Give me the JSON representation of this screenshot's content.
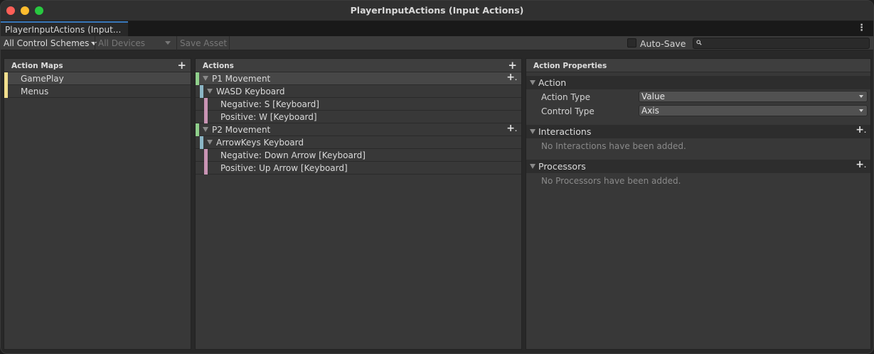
{
  "window": {
    "title": "PlayerInputActions (Input Actions)"
  },
  "tab": {
    "label": "PlayerInputActions (Input..."
  },
  "toolbar": {
    "control_schemes": "All Control Schemes",
    "devices": "All Devices",
    "save_asset": "Save Asset",
    "auto_save": "Auto-Save",
    "search_value": ""
  },
  "action_maps": {
    "header": "Action Maps",
    "items": [
      {
        "label": "GamePlay",
        "color": "#f2df8e"
      },
      {
        "label": "Menus",
        "color": "#f2df8e"
      }
    ]
  },
  "actions": {
    "header": "Actions",
    "rows": [
      {
        "label": "P1 Movement",
        "kind": "action",
        "color": "#8fcf8b"
      },
      {
        "label": "WASD Keyboard",
        "kind": "composite",
        "color": "#8bb6c6"
      },
      {
        "label": "Negative: S [Keyboard]",
        "kind": "binding",
        "color": "#c994b4"
      },
      {
        "label": "Positive: W [Keyboard]",
        "kind": "binding",
        "color": "#c994b4"
      },
      {
        "label": "P2 Movement",
        "kind": "action",
        "color": "#8fcf8b"
      },
      {
        "label": "ArrowKeys Keyboard",
        "kind": "composite",
        "color": "#8bb6c6"
      },
      {
        "label": "Negative: Down Arrow [Keyboard]",
        "kind": "binding",
        "color": "#c994b4"
      },
      {
        "label": "Positive: Up Arrow [Keyboard]",
        "kind": "binding",
        "color": "#c994b4"
      }
    ]
  },
  "properties": {
    "header": "Action Properties",
    "action_section": "Action",
    "action_type_label": "Action Type",
    "action_type_value": "Value",
    "control_type_label": "Control Type",
    "control_type_value": "Axis",
    "interactions_section": "Interactions",
    "interactions_empty": "No Interactions have been added.",
    "processors_section": "Processors",
    "processors_empty": "No Processors have been added."
  },
  "icons": [
    "plus-icon",
    "triangle-down-icon",
    "search-icon",
    "kebab-menu-icon"
  ]
}
